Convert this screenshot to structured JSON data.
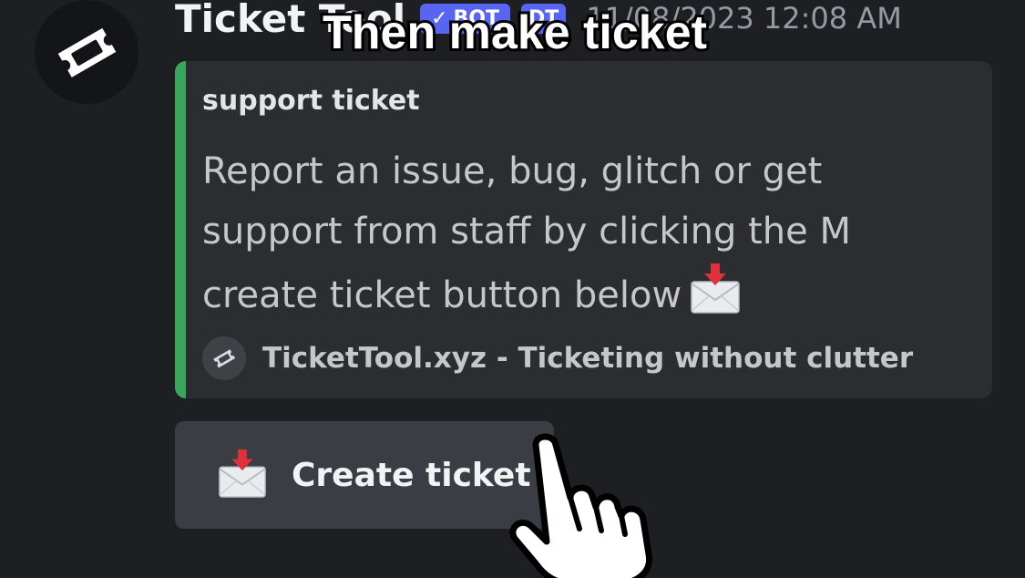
{
  "header": {
    "username": "Ticket Tool",
    "bot_badge": "BOT",
    "tag_badge": "DT",
    "timestamp": "11/08/2023 12:08 AM"
  },
  "caption": "Then make ticket",
  "embed": {
    "accent_color": "#3ba55c",
    "title": "support ticket",
    "description_lines": [
      "Report an issue, bug, glitch or get",
      "support from staff by clicking the M",
      "create ticket button below"
    ],
    "footer": "TicketTool.xyz - Ticketing without clutter"
  },
  "button": {
    "label": "Create ticket",
    "icon": "envelope-with-arrow-icon"
  },
  "colors": {
    "background": "#1e1f22",
    "embed_bg": "#2b2d31",
    "button_bg": "#3b3d44",
    "blurple": "#5865f2"
  }
}
